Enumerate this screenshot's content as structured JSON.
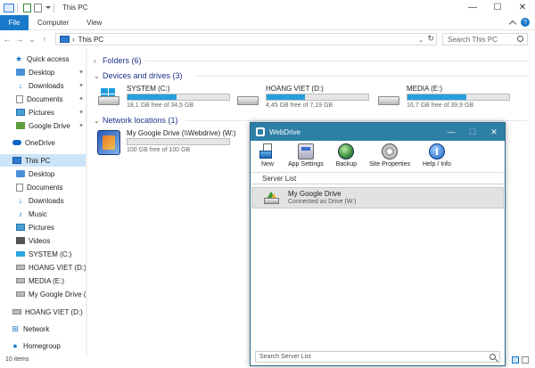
{
  "window": {
    "title": "This PC",
    "controls": {
      "minimize": "—",
      "maximize": "☐",
      "close": "✕"
    }
  },
  "ribbon": {
    "tabs": [
      "File",
      "Computer",
      "View"
    ]
  },
  "address": {
    "path": "This PC",
    "separator": "›",
    "search_placeholder": "Search This PC"
  },
  "sidebar": {
    "items": [
      {
        "label": "Quick access",
        "icon": "star-icon"
      },
      {
        "label": "Desktop",
        "icon": "folder-icon",
        "pinned": true
      },
      {
        "label": "Downloads",
        "icon": "download-icon",
        "pinned": true
      },
      {
        "label": "Documents",
        "icon": "document-icon",
        "pinned": true
      },
      {
        "label": "Pictures",
        "icon": "pictures-icon",
        "pinned": true
      },
      {
        "label": "Google Drive",
        "icon": "google-drive-icon",
        "pinned": true
      },
      {
        "label": "OneDrive",
        "icon": "cloud-icon"
      },
      {
        "label": "This PC",
        "icon": "computer-icon",
        "selected": true
      },
      {
        "label": "Desktop",
        "icon": "folder-icon"
      },
      {
        "label": "Documents",
        "icon": "document-icon"
      },
      {
        "label": "Downloads",
        "icon": "download-icon"
      },
      {
        "label": "Music",
        "icon": "music-icon"
      },
      {
        "label": "Pictures",
        "icon": "pictures-icon"
      },
      {
        "label": "Videos",
        "icon": "video-icon"
      },
      {
        "label": "SYSTEM (C:)",
        "icon": "windows-drive-icon"
      },
      {
        "label": "HOANG VIET (D:)",
        "icon": "drive-icon"
      },
      {
        "label": "MEDIA (E:)",
        "icon": "drive-icon"
      },
      {
        "label": "My Google Drive (\\\\",
        "icon": "network-drive-icon"
      },
      {
        "label": "HOANG VIET (D:)",
        "icon": "drive-icon"
      },
      {
        "label": "Network",
        "icon": "network-icon"
      },
      {
        "label": "Homegroup",
        "icon": "homegroup-icon"
      }
    ],
    "status": "10 items"
  },
  "content": {
    "groups": {
      "folders": "Folders (6)",
      "devices": "Devices and drives (3)",
      "network": "Network locations (1)"
    },
    "drives": [
      {
        "name": "SYSTEM (C:)",
        "free": "18,1 GB free of 34,5 GB",
        "used_fraction": 0.48,
        "windows": true
      },
      {
        "name": "HOANG VIET (D:)",
        "free": "4,45 GB free of 7,19 GB",
        "used_fraction": 0.38,
        "windows": false
      },
      {
        "name": "MEDIA (E:)",
        "free": "16,7 GB free of 39,9 GB",
        "used_fraction": 0.58,
        "windows": false
      }
    ],
    "network_location": {
      "name": "My Google Drive (\\\\Webdrive) (W:)",
      "free": "100 GB free of 100 GB",
      "used_fraction": 0.0
    }
  },
  "webdrive": {
    "title": "WebDrive",
    "controls": {
      "minimize": "—",
      "maximize": "☐",
      "close": "✕"
    },
    "toolbar": [
      {
        "label": "New",
        "icon": "new-icon"
      },
      {
        "label": "App Settings",
        "icon": "app-settings-icon"
      },
      {
        "label": "Backup",
        "icon": "backup-icon"
      },
      {
        "label": "Site Properties",
        "icon": "site-properties-icon"
      },
      {
        "label": "Help / Info",
        "icon": "help-icon"
      }
    ],
    "help_glyph": "i",
    "server_list_header": "Server List",
    "servers": [
      {
        "name": "My Google Drive",
        "status": "Connected as Drive (W:)"
      }
    ],
    "search_placeholder": "Search Server List"
  },
  "colors": {
    "accent": "#1979ca",
    "drive_fill": "#26a0da",
    "webdrive_title": "#2e7fa5",
    "group_header": "#1e3287"
  }
}
